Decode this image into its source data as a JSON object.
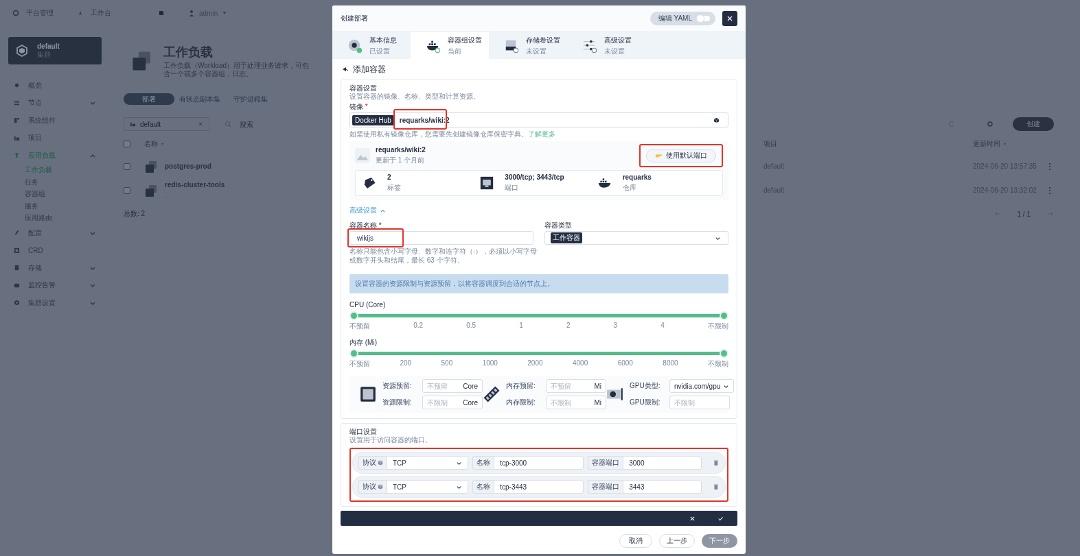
{
  "topbar": {
    "items": [
      {
        "kind": "platform",
        "label": "平台管理"
      },
      {
        "kind": "workbench",
        "label": "工作台"
      }
    ],
    "user": "admin"
  },
  "cluster": {
    "name": "default",
    "type": "集群"
  },
  "sidebar": {
    "items": [
      {
        "kind": "overview",
        "label": "概览",
        "selected": false
      },
      {
        "kind": "nodes",
        "label": "节点",
        "selected": false,
        "expanded": false
      },
      {
        "kind": "components",
        "label": "系统组件",
        "selected": false
      },
      {
        "kind": "projects",
        "label": "项目",
        "selected": false
      },
      {
        "kind": "workloads",
        "label": "应用负载",
        "selected": true,
        "expanded": true,
        "children": [
          {
            "label": "工作负载",
            "selected": true
          },
          {
            "label": "任务",
            "selected": false
          },
          {
            "label": "容器组",
            "selected": false
          },
          {
            "label": "服务",
            "selected": false
          },
          {
            "label": "应用路由",
            "selected": false
          }
        ]
      },
      {
        "kind": "config",
        "label": "配置",
        "selected": false,
        "expanded": false
      },
      {
        "kind": "crd",
        "label": "CRD",
        "selected": false
      },
      {
        "kind": "storage",
        "label": "存储",
        "selected": false,
        "expanded": false
      },
      {
        "kind": "monitor",
        "label": "监控告警",
        "selected": false,
        "expanded": false
      },
      {
        "kind": "settings",
        "label": "集群设置",
        "selected": false,
        "expanded": false
      }
    ]
  },
  "page": {
    "title": "工作负载",
    "description": "工作负载（Workload）用于处理业务请求，可包含一个或多个容器组，日志、"
  },
  "tabs": [
    {
      "label": "部署",
      "selected": true
    },
    {
      "label": "有状态副本集",
      "selected": false
    },
    {
      "label": "守护进程集",
      "selected": false
    }
  ],
  "filter": {
    "value": "default"
  },
  "search": {
    "placeholder": "搜索"
  },
  "create_button": "创建",
  "table": {
    "all_checked": false,
    "columns": [
      "名称",
      "项目",
      "更新时间"
    ],
    "rows": [
      {
        "checked": false,
        "name": "postgres-prod",
        "subtitle": "",
        "project": "default",
        "updated": "2024-06-20 13:57:35"
      },
      {
        "checked": false,
        "name": "redis-cluster-tools",
        "subtitle": "-",
        "project": "default",
        "updated": "2024-06-20 13:32:02"
      }
    ]
  },
  "total": "总数: 2",
  "pagination": "1 / 1",
  "dialog": {
    "title": "创建部署",
    "yaml_toggle": {
      "label": "编辑 YAML",
      "on": false
    },
    "steps": [
      {
        "kind": "disc",
        "title": "基本信息",
        "status": "已设置",
        "done": true,
        "selected": false
      },
      {
        "kind": "docker",
        "title": "容器组设置",
        "status": "当前",
        "done": false,
        "selected": true
      },
      {
        "kind": "drive",
        "title": "存储卷设置",
        "status": "未设置",
        "done": false,
        "selected": false
      },
      {
        "kind": "sliders",
        "title": "高级设置",
        "status": "未设置",
        "done": false,
        "selected": false
      }
    ],
    "heading": "添加容器",
    "container": {
      "title": "容器设置",
      "description": "设置容器的镜像、名称、类型和计算资源。",
      "image_label": "镜像",
      "image_required": "*",
      "registry": "Docker Hub",
      "image": "requarks/wiki:2",
      "image_highlighted": true,
      "image_hint": "如需使用私有镜像仓库，您需要先创建镜像仓库保密字典。",
      "image_hint_link": "了解更多",
      "image_info": {
        "name": "requarks/wiki:2",
        "updated": "更新于 1 个月前",
        "button": "使用默认端口",
        "button_highlighted": true,
        "stats": [
          {
            "kind": "tag",
            "value": "2",
            "label": "标签"
          },
          {
            "kind": "port",
            "value": "3000/tcp; 3443/tcp",
            "label": "端口"
          },
          {
            "kind": "docker",
            "value": "requarks",
            "label": "仓库"
          }
        ]
      },
      "advanced": {
        "label": "高级设置",
        "expanded": true
      },
      "name_label": "容器名称",
      "name_required": "*",
      "name": "wikijs",
      "name_highlighted": true,
      "type_label": "容器类型",
      "type": "工作容器",
      "name_hint": "名称只能包含小写字母、数字和连字符（-），必须以小写字母或数字开头和结尾，最长 63 个字符。",
      "resource_note": "设置容器的资源限制与资源预留，以将容器调度到合适的节点上。",
      "sliders": [
        {
          "label": "CPU (Core)",
          "level": 1,
          "ticks": [
            "不预留",
            "0.2",
            "0.5",
            "1",
            "2",
            "3",
            "4",
            "不限制"
          ]
        },
        {
          "label": "内存 (Mi)",
          "level": 1,
          "ticks": [
            "不预留",
            "200",
            "500",
            "1000",
            "2000",
            "4000",
            "6000",
            "8000",
            "不限制"
          ]
        }
      ],
      "resources": [
        {
          "kind": "cpu",
          "fields": [
            {
              "kind": "input",
              "label": "资源预留:",
              "placeholder": "不预留",
              "unit": "Core"
            },
            {
              "kind": "input",
              "label": "资源限制:",
              "placeholder": "不限制",
              "unit": "Core"
            }
          ]
        },
        {
          "kind": "memory",
          "fields": [
            {
              "kind": "input",
              "label": "内存预留:",
              "placeholder": "不预留",
              "unit": "Mi"
            },
            {
              "kind": "input",
              "label": "内存限制:",
              "placeholder": "不限制",
              "unit": "Mi"
            }
          ]
        },
        {
          "kind": "gpu",
          "fields": [
            {
              "kind": "select",
              "label": "GPU类型:",
              "value": "nvidia.com/gpu"
            },
            {
              "kind": "input",
              "label": "GPU限制:",
              "placeholder": "不限制"
            }
          ]
        }
      ]
    },
    "ports": {
      "title": "端口设置",
      "description": "设置用于访问容器的端口。",
      "highlighted": true,
      "rows": [
        {
          "protocol_label": "协议",
          "protocol": "TCP",
          "name_label": "名称",
          "name": "tcp-3000",
          "port_label": "容器端口",
          "port": "3000"
        },
        {
          "protocol_label": "协议",
          "protocol": "TCP",
          "name_label": "名称",
          "name": "tcp-3443",
          "port_label": "容器端口",
          "port": "3443"
        }
      ]
    },
    "buttons": [
      {
        "kind": "cancel",
        "label": "取消"
      },
      {
        "kind": "back",
        "label": "上一步"
      },
      {
        "kind": "next",
        "label": "下一步"
      }
    ]
  }
}
